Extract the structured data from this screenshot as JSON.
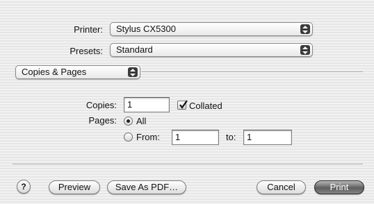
{
  "printer": {
    "label": "Printer:",
    "value": "Stylus CX5300"
  },
  "presets": {
    "label": "Presets:",
    "value": "Standard"
  },
  "pane": {
    "value": "Copies & Pages"
  },
  "copies": {
    "label": "Copies:",
    "value": "1",
    "collated_label": "Collated",
    "collated_checked": true
  },
  "pages": {
    "label": "Pages:",
    "all_label": "All",
    "all_selected": true,
    "from_label": "From:",
    "from_value": "1",
    "to_label": "to:",
    "to_value": "1"
  },
  "buttons": {
    "help": "?",
    "preview": "Preview",
    "save_pdf": "Save As PDF…",
    "cancel": "Cancel",
    "print": "Print"
  }
}
